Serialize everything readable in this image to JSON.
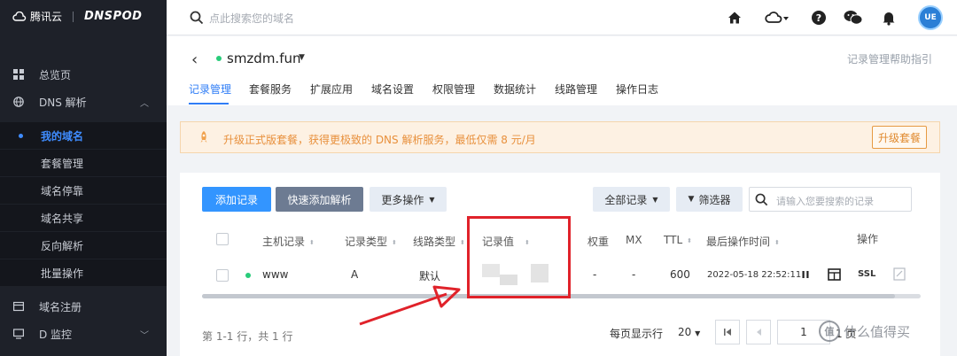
{
  "brand": {
    "tencent": "腾讯云",
    "dnspod": "DNSPOD"
  },
  "sidebar": {
    "items": [
      {
        "label": "总览页",
        "icon": "dashboard-icon"
      },
      {
        "label": "DNS 解析",
        "icon": "globe-icon"
      },
      {
        "label": "域名注册",
        "icon": "domain-register-icon"
      },
      {
        "label": "D 监控",
        "icon": "monitor-icon"
      }
    ],
    "submenu": [
      "我的域名",
      "套餐管理",
      "域名停靠",
      "域名共享",
      "反向解析",
      "批量操作"
    ],
    "active_submenu": "我的域名"
  },
  "topbar": {
    "search_placeholder": "点此搜索您的域名"
  },
  "header": {
    "domain": "smzdm.fun",
    "help_link": "记录管理帮助指引",
    "tabs": [
      "记录管理",
      "套餐服务",
      "扩展应用",
      "域名设置",
      "权限管理",
      "数据统计",
      "线路管理",
      "操作日志"
    ],
    "active_tab": "记录管理"
  },
  "banner": {
    "text": "升级正式版套餐，获得更极致的 DNS 解析服务，最低仅需 8 元/月",
    "button": "升级套餐"
  },
  "toolbar": {
    "add_record": "添加记录",
    "quick_add": "快速添加解析",
    "more_actions": "更多操作",
    "all_records": "全部记录",
    "filter": "筛选器",
    "search_placeholder": "请输入您要搜索的记录"
  },
  "table": {
    "headers": [
      "主机记录",
      "记录类型",
      "线路类型",
      "记录值",
      "权重",
      "MX",
      "TTL",
      "最后操作时间",
      "操作"
    ],
    "rows": [
      {
        "host": "www",
        "type": "A",
        "line": "默认",
        "value": "",
        "weight": "-",
        "mx": "-",
        "ttl": "600",
        "updated": "2022-05-18 22:52:11",
        "ssl": "SSL"
      }
    ]
  },
  "pagination": {
    "count_text": "第 1-1 行，共 1 行",
    "per_page_label": "每页显示行",
    "page_size": "20",
    "current_page": "1",
    "total_pages": "1 页"
  },
  "watermark": {
    "text": "什么值得买",
    "badge": "值"
  },
  "colors": {
    "primary": "#3395ff",
    "sidebar": "#1e2129",
    "status_green": "#29cc7a",
    "highlight_red": "#e0222a",
    "banner_orange": "#e8903c"
  }
}
